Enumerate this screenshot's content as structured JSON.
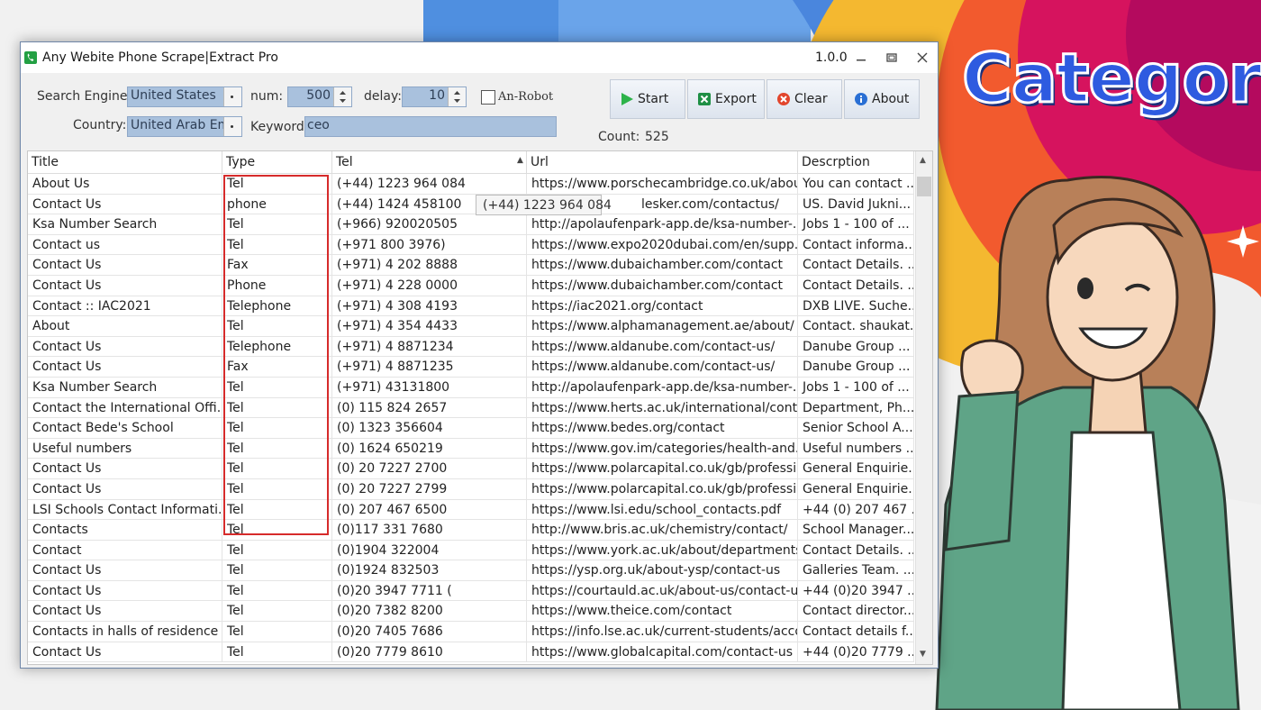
{
  "window": {
    "title": "Any Webite Phone Scrape|Extract Pro",
    "version": "1.0.0"
  },
  "form": {
    "search_engine_label": "Search Engine:",
    "search_engine_value": "United States",
    "num_label": "num:",
    "num_value": "500",
    "delay_label": "delay:",
    "delay_value": "10",
    "robot_label": "An-Robot",
    "country_label": "Country:",
    "country_value": "United Arab Em",
    "keyword_label": "Keyword:",
    "keyword_value": "ceo"
  },
  "toolbar": {
    "start": "Start",
    "export": "Export",
    "clear": "Clear",
    "about": "About"
  },
  "count": {
    "label": "Count:",
    "value": "525"
  },
  "table": {
    "headers": [
      "Title",
      "Type",
      "Tel",
      "Url",
      "Descrption"
    ],
    "rows": [
      [
        "About Us",
        "Tel",
        "(+44) 1223 964 084",
        "https://www.porschecambridge.co.uk/abou...",
        "You can contact ..."
      ],
      [
        "Contact Us",
        "phone",
        "(+44) 1424 458100",
        "lesker.com/contactus/",
        "US. David Jukni..."
      ],
      [
        "Ksa Number Search",
        "Tel",
        "(+966) 920020505",
        "http://apolaufenpark-app.de/ksa-number-...",
        "Jobs 1 - 100 of ..."
      ],
      [
        "Contact us",
        "Tel",
        "(+971 800 3976)",
        "https://www.expo2020dubai.com/en/supp...",
        "Contact informa..."
      ],
      [
        "Contact Us",
        "Fax",
        "(+971) 4 202 8888",
        "https://www.dubaichamber.com/contact",
        "Contact Details. ..."
      ],
      [
        "Contact Us",
        "Phone",
        "(+971) 4 228 0000",
        "https://www.dubaichamber.com/contact",
        "Contact Details. ..."
      ],
      [
        "Contact :: IAC2021",
        "Telephone",
        "(+971) 4 308 4193",
        "https://iac2021.org/contact",
        "DXB LIVE. Suche..."
      ],
      [
        "About",
        "Tel",
        "(+971) 4 354 4433",
        "https://www.alphamanagement.ae/about/",
        "Contact. shaukat..."
      ],
      [
        "Contact Us",
        "Telephone",
        "(+971) 4 8871234",
        "https://www.aldanube.com/contact-us/",
        "Danube Group ..."
      ],
      [
        "Contact Us",
        "Fax",
        "(+971) 4 8871235",
        "https://www.aldanube.com/contact-us/",
        "Danube Group ..."
      ],
      [
        "Ksa Number Search",
        "Tel",
        "(+971) 43131800",
        "http://apolaufenpark-app.de/ksa-number-...",
        "Jobs 1 - 100 of ..."
      ],
      [
        "Contact the International Offi...",
        "Tel",
        "(0) 115 824 2657",
        "https://www.herts.ac.uk/international/conta...",
        "Department, Ph..."
      ],
      [
        "Contact Bede's School",
        "Tel",
        "(0) 1323 356604",
        "https://www.bedes.org/contact",
        "Senior School A..."
      ],
      [
        "Useful numbers",
        "Tel",
        "(0) 1624 650219",
        "https://www.gov.im/categories/health-and...",
        "Useful numbers ..."
      ],
      [
        "Contact Us",
        "Tel",
        "(0) 20 7227 2700",
        "https://www.polarcapital.co.uk/gb/professi...",
        "General Enquirie..."
      ],
      [
        "Contact Us",
        "Tel",
        "(0) 20 7227 2799",
        "https://www.polarcapital.co.uk/gb/professi...",
        "General Enquirie..."
      ],
      [
        "LSI Schools Contact Informati...",
        "Tel",
        "(0) 207 467 6500",
        "https://www.lsi.edu/school_contacts.pdf",
        "+44 (0) 207 467 ..."
      ],
      [
        "Contacts",
        "Tel",
        "(0)117 331 7680",
        "http://www.bris.ac.uk/chemistry/contact/",
        "School Manager..."
      ],
      [
        "Contact",
        "Tel",
        "(0)1904 322004",
        "https://www.york.ac.uk/about/departments...",
        "Contact Details. ..."
      ],
      [
        "Contact Us",
        "Tel",
        "(0)1924 832503",
        "https://ysp.org.uk/about-ysp/contact-us",
        "Galleries Team. ..."
      ],
      [
        "Contact Us",
        "Tel",
        "(0)20 3947 7711 (",
        "https://courtauld.ac.uk/about-us/contact-us/",
        "+44 (0)20 3947 ..."
      ],
      [
        "Contact Us",
        "Tel",
        "(0)20 7382 8200",
        "https://www.theice.com/contact",
        "Contact director..."
      ],
      [
        "Contacts in halls of residence",
        "Tel",
        "(0)20 7405 7686",
        "https://info.lse.ac.uk/current-students/acco...",
        "Contact details f..."
      ],
      [
        "Contact Us",
        "Tel",
        "(0)20 7779 8610",
        "https://www.globalcapital.com/contact-us",
        "+44 (0)20 7779 ..."
      ]
    ]
  },
  "tooltip": "(+44) 1223 964 084",
  "banner": {
    "text": "Category"
  },
  "colors": {
    "accent": "#2e5be0",
    "highlight": "#d62b2b",
    "field": "#a9c1dd"
  }
}
